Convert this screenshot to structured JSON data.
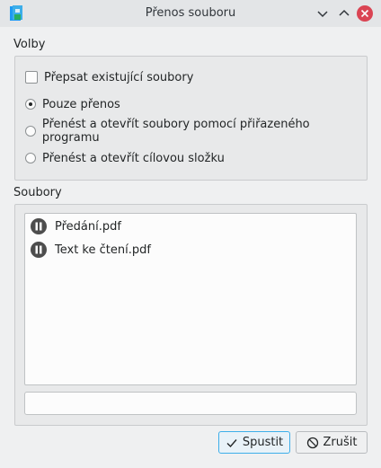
{
  "window": {
    "title": "Přenos souboru",
    "icon": "file-transfer-icon"
  },
  "options": {
    "label": "Volby",
    "overwrite_label": "Přepsat existující soubory",
    "overwrite_checked": false,
    "radios": [
      {
        "label": "Pouze přenos",
        "checked": true
      },
      {
        "label": "Přenést a otevřít soubory pomocí přiřazeného programu",
        "checked": false
      },
      {
        "label": "Přenést a otevřít cílovou složku",
        "checked": false
      }
    ]
  },
  "files": {
    "label": "Soubory",
    "items": [
      {
        "name": "Předání.pdf",
        "status_icon": "pause-icon"
      },
      {
        "name": "Text ke čtení.pdf",
        "status_icon": "pause-icon"
      }
    ],
    "path_value": ""
  },
  "buttons": {
    "start": "Spustit",
    "cancel": "Zrušit"
  },
  "colors": {
    "accent": "#3daee9",
    "close": "#da4453"
  }
}
